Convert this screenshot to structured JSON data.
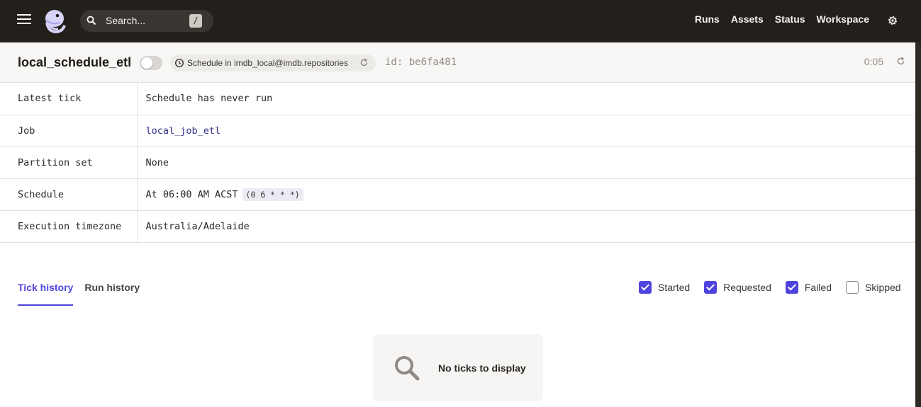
{
  "nav": {
    "search_placeholder": "Search...",
    "search_shortcut": "/",
    "links": [
      "Runs",
      "Assets",
      "Status",
      "Workspace"
    ]
  },
  "schedule": {
    "name": "local_schedule_etl",
    "repo_prefix": "Schedule in",
    "repo_location": "imdb_local@imdb.repositories",
    "id": "id: be6fa481",
    "refresh_timer": "0:05"
  },
  "details": [
    {
      "key": "Latest tick",
      "value": "Schedule has never run"
    },
    {
      "key": "Job",
      "value": "local_job_etl"
    },
    {
      "key": "Partition set",
      "value": "None"
    },
    {
      "key": "Schedule",
      "value": "At 06:00 AM ACST",
      "cron": "(0 6 * * *)"
    },
    {
      "key": "Execution timezone",
      "value": "Australia/Adelaide"
    }
  ],
  "tabs": [
    "Tick history",
    "Run history"
  ],
  "filters": [
    {
      "label": "Started",
      "checked": true
    },
    {
      "label": "Requested",
      "checked": true
    },
    {
      "label": "Failed",
      "checked": true
    },
    {
      "label": "Skipped",
      "checked": false
    }
  ],
  "empty_message": "No ticks to display",
  "colors": {
    "accent": "#4f43dd",
    "nav_bg": "#231f1b"
  }
}
